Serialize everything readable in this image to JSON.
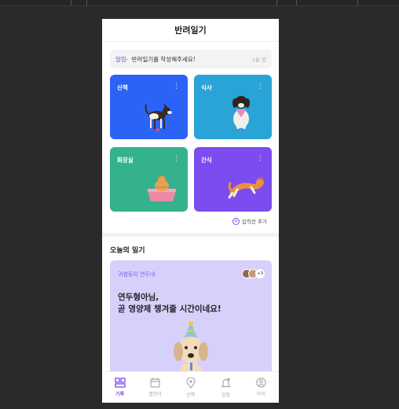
{
  "app": {
    "title": "반려일기"
  },
  "notice": {
    "tag": "알림-",
    "message": "반려일기를 작성해주세요!",
    "time": "1분 전"
  },
  "cards": [
    {
      "label": "산책",
      "color": "#2b63f6",
      "icon": "walking-dog-icon"
    },
    {
      "label": "식사",
      "color": "#2aa3d6",
      "icon": "sitting-dog-icon"
    },
    {
      "label": "화장실",
      "color": "#34b28e",
      "icon": "cat-litter-icon"
    },
    {
      "label": "간식",
      "color": "#7c4cf0",
      "icon": "jumping-cat-icon"
    }
  ],
  "add_field": {
    "label": "입력칸 추가"
  },
  "today": {
    "section_title": "오늘의 일기",
    "subtitle": "귀염둥이 연두네",
    "member_more": "+3",
    "headline_line1": "연두형아님,",
    "headline_line2": "곧 영양제 챙겨줄 시간이네요!"
  },
  "tabs": [
    {
      "label": "기록",
      "icon": "record-icon",
      "active": true
    },
    {
      "label": "캘린더",
      "icon": "calendar-icon",
      "active": false
    },
    {
      "label": "산책",
      "icon": "location-icon",
      "active": false
    },
    {
      "label": "알림",
      "icon": "bell-icon",
      "active": false
    },
    {
      "label": "마이",
      "icon": "profile-icon",
      "active": false
    }
  ],
  "colors": {
    "accent": "#7b4fe0",
    "diary_bg": "#d7d0fb"
  }
}
